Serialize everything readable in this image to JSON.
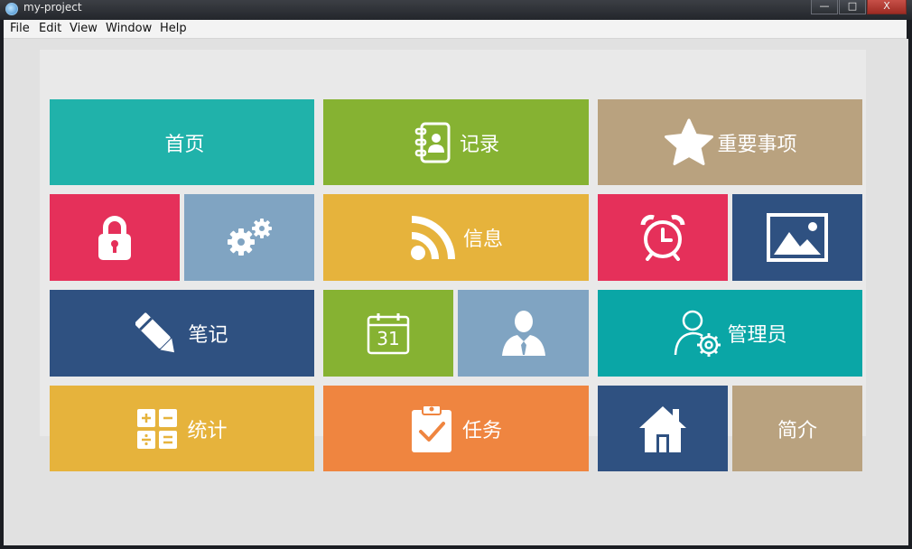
{
  "window": {
    "title": "my-project",
    "controls": {
      "minimize": "—",
      "maximize": "□",
      "close": "X"
    }
  },
  "menu": [
    "File",
    "Edit",
    "View",
    "Window",
    "Help"
  ],
  "colors": {
    "teal": "#20b2aa",
    "green": "#86b232",
    "khaki": "#b9a27f",
    "crimson": "#e5305a",
    "steel": "#80a4c2",
    "amber": "#e6b33c",
    "navy": "#2f5181",
    "cyan": "#0aa6a6",
    "orange": "#ef8540"
  },
  "tiles": {
    "home": {
      "label": "首页"
    },
    "records": {
      "label": "记录",
      "icon": "address-book-icon"
    },
    "important": {
      "label": "重要事项",
      "icon": "star-icon"
    },
    "lock": {
      "icon": "lock-icon"
    },
    "settings": {
      "icon": "gears-icon"
    },
    "info": {
      "label": "信息",
      "icon": "rss-icon"
    },
    "alarm": {
      "icon": "alarm-clock-icon"
    },
    "gallery": {
      "icon": "image-icon"
    },
    "notes": {
      "label": "笔记",
      "icon": "pencil-icon"
    },
    "calendar": {
      "icon": "calendar-icon",
      "day": "31"
    },
    "user": {
      "icon": "user-tie-icon"
    },
    "admin": {
      "label": "管理员",
      "icon": "user-gear-icon"
    },
    "stats": {
      "label": "统计",
      "icon": "calculator-icon"
    },
    "tasks": {
      "label": "任务",
      "icon": "clipboard-check-icon"
    },
    "house": {
      "icon": "house-icon"
    },
    "intro": {
      "label": "简介"
    }
  }
}
